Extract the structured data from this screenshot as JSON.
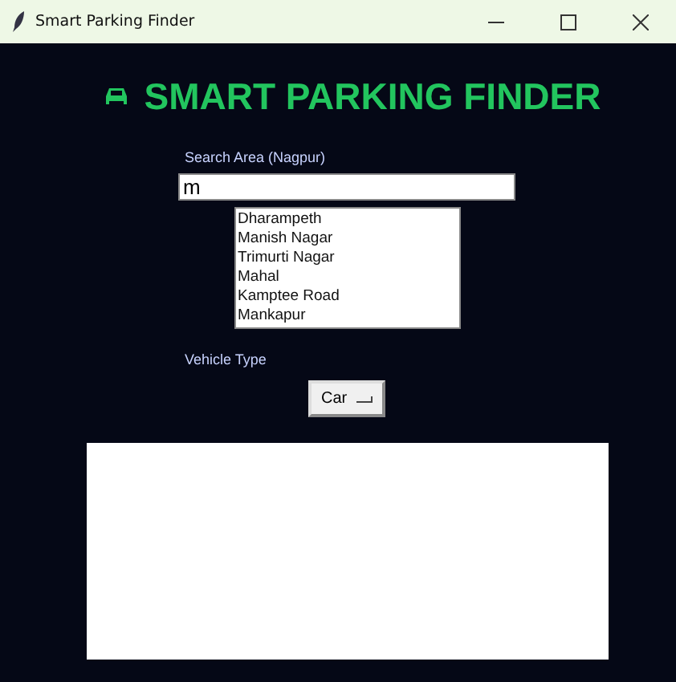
{
  "window": {
    "title": "Smart Parking Finder"
  },
  "heading": "SMART PARKING FINDER",
  "search": {
    "label": "Search Area (Nagpur)",
    "value": "m"
  },
  "suggestions": [
    {
      "label": "Dharampeth"
    },
    {
      "label": "Manish Nagar"
    },
    {
      "label": "Trimurti Nagar"
    },
    {
      "label": "Mahal"
    },
    {
      "label": "Kamptee Road"
    },
    {
      "label": "Mankapur"
    }
  ],
  "vehicle": {
    "label": "Vehicle Type",
    "value": "Car"
  }
}
